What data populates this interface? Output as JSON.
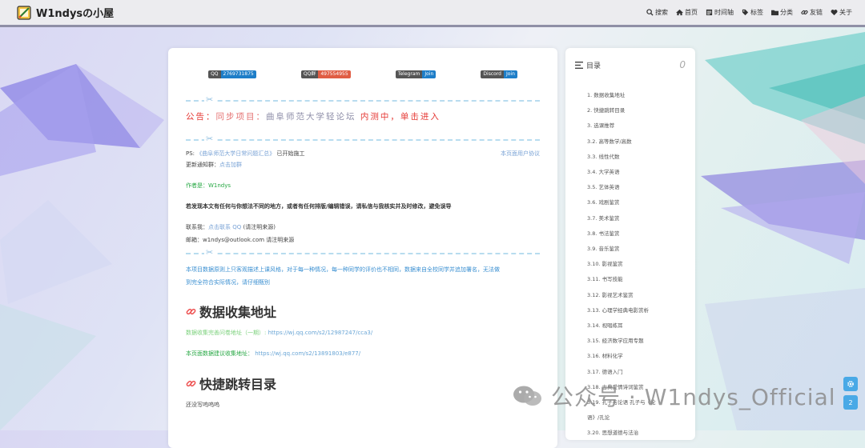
{
  "site": {
    "title": "W1ndysの小屋"
  },
  "nav": [
    {
      "icon": "search-icon",
      "label": "搜索"
    },
    {
      "icon": "home-icon",
      "label": "首页"
    },
    {
      "icon": "timeline-icon",
      "label": "时间轴"
    },
    {
      "icon": "tag-icon",
      "label": "标签"
    },
    {
      "icon": "folder-icon",
      "label": "分类"
    },
    {
      "icon": "link-icon",
      "label": "友链"
    },
    {
      "icon": "heart-icon",
      "label": "关于"
    }
  ],
  "badges": [
    {
      "label": "QQ",
      "value": "2769731875",
      "color": "#1e7ec8"
    },
    {
      "label": "QQ群",
      "value": "497554955",
      "color": "#e05d44"
    },
    {
      "label": "Telegram",
      "value": "Join",
      "color": "#1e7ec8"
    },
    {
      "label": "Discord",
      "value": "Join",
      "color": "#1e7ec8"
    }
  ],
  "announcement": {
    "prefix": "公告：",
    "project": "同步项目：",
    "forum": "曲阜师范大学轻论坛",
    "status": "内测中，单击进入"
  },
  "ps": {
    "label": "PS:",
    "link": "《曲阜师范大学日常问题汇总》",
    "suffix": "已开始施工",
    "agreement": "本页面用户协议"
  },
  "notify": {
    "label": "更新通知群：",
    "link": "点击加群"
  },
  "author": "作者是：W1ndys",
  "notice": "若发现本文有任何与你想法不同的地方，或者有任何排版/编辑错误，请私信与我核实并及时修改，避免误导",
  "contact": {
    "label": "联系我：",
    "link": "点击联系 QQ",
    "suffix": "(请注明来源)"
  },
  "email": {
    "label": "邮箱：",
    "value": "w1ndys@outlook.com 请注明来源"
  },
  "disclaimer_line1": "本项目数据原则上只客观描述上课风格，对于每一种情况，每一种同学的评价也不相同，数据来自全校同学并追加署名，无法做",
  "disclaimer_line2": "到完全符合实际情况，请仔细甄别",
  "section1": {
    "title": "数据收集地址",
    "line1_label": "数据收集完善问卷地址（一期）:",
    "line1_url": "https://wj.qq.com/s2/12987247/cca3/",
    "line2_label": "本页面数据建议收集地址：",
    "line2_url": "https://wj.qq.com/s2/13891803/e877/"
  },
  "section2": {
    "title": "快捷跳转目录",
    "body": "还没写呜呜呜"
  },
  "toc": {
    "title": "目录",
    "count": "0",
    "items": [
      "1. 数据收集地址",
      "2. 快捷跳转目录",
      "3. 选课推荐",
      "3.2. 高等数学/高数",
      "3.3. 线性代数",
      "3.4. 大学英语",
      "3.5. 艺体英语",
      "3.6. 戏剧鉴赏",
      "3.7. 美术鉴赏",
      "3.8. 书法鉴赏",
      "3.9. 音乐鉴赏",
      "3.10. 影视鉴赏",
      "3.11. 书写技能",
      "3.12. 影视艺术鉴赏",
      "3.13. 心理学经典电影赏析",
      "3.14. 视唱练耳",
      "3.15. 经济数学应用专题",
      "3.16. 材料化学",
      "3.17. 德语入门",
      "3.18. 古典爱情诗词鉴赏",
      "3.19. 孔子与论语 孔子与《论",
      "语》/孔论",
      "3.20. 思想道德与法治"
    ]
  },
  "float": {
    "page": "2"
  },
  "watermark": {
    "text": "公众号 · W1ndys_Official"
  }
}
